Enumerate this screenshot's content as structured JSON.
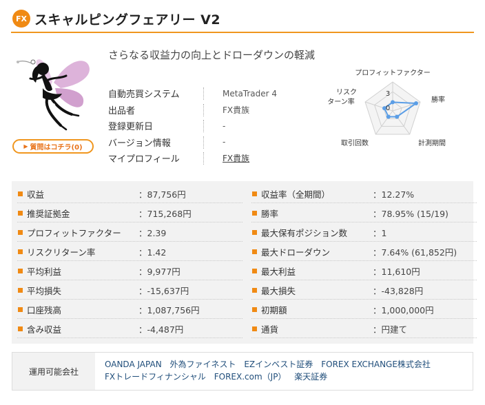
{
  "header": {
    "badge": "FX",
    "title": "スキャルピングフェアリー V2"
  },
  "ask_button": {
    "label": "質問はコチラ(0)"
  },
  "subtitle": "さらなる収益力の向上とドローダウンの軽減",
  "info": [
    {
      "key": "自動売買システム",
      "value": "MetaTrader 4",
      "link": false
    },
    {
      "key": "出品者",
      "value": "FX貴族",
      "link": false
    },
    {
      "key": "登録更新日",
      "value": "-",
      "link": false
    },
    {
      "key": "バージョン情報",
      "value": "-",
      "link": false
    },
    {
      "key": "マイプロフィール",
      "value": "FX貴族",
      "link": true
    }
  ],
  "radar": {
    "axes": [
      "プロフィットファクター",
      "勝率",
      "計測期間",
      "取引回数",
      "リスクリターン率"
    ],
    "risk_label_line1": "リスク",
    "risk_label_line2": "ターン率",
    "scale_max": "3",
    "scale_min": "0",
    "values": [
      0.3,
      0.85,
      0.25,
      0.25,
      0.3
    ],
    "color": "#5b9ee6"
  },
  "stats": {
    "left": [
      {
        "key": "収益",
        "value": "：87,756円"
      },
      {
        "key": "推奨証拠金",
        "value": "：715,268円"
      },
      {
        "key": "プロフィットファクター",
        "value": "：2.39"
      },
      {
        "key": "リスクリターン率",
        "value": "：1.42"
      },
      {
        "key": "平均利益",
        "value": "：9,977円"
      },
      {
        "key": "平均損失",
        "value": "：-15,637円"
      },
      {
        "key": "口座残高",
        "value": "：1,087,756円"
      },
      {
        "key": "含み収益",
        "value": "：-4,487円"
      }
    ],
    "right": [
      {
        "key": "収益率（全期間）",
        "value": "：12.27%"
      },
      {
        "key": "勝率",
        "value": "：78.95% (15/19)"
      },
      {
        "key": "最大保有ポジション数",
        "value": "：1"
      },
      {
        "key": "最大ドローダウン",
        "value": "：7.64% (61,852円)"
      },
      {
        "key": "最大利益",
        "value": "：11,610円"
      },
      {
        "key": "最大損失",
        "value": "：-43,828円"
      },
      {
        "key": "初期額",
        "value": "：1,000,000円"
      },
      {
        "key": "通貨",
        "value": "：円建て"
      }
    ]
  },
  "companies": {
    "label": "運用可能会社",
    "line1": [
      "OANDA JAPAN",
      "外為ファイネスト",
      "EZインベスト証券",
      "FOREX EXCHANGE株式会社"
    ],
    "line2": [
      "FXトレードフィナンシャル",
      "FOREX.com（JP）",
      "楽天証券"
    ]
  },
  "colors": {
    "accent": "#f08a14",
    "link": "#1f4d7a"
  }
}
